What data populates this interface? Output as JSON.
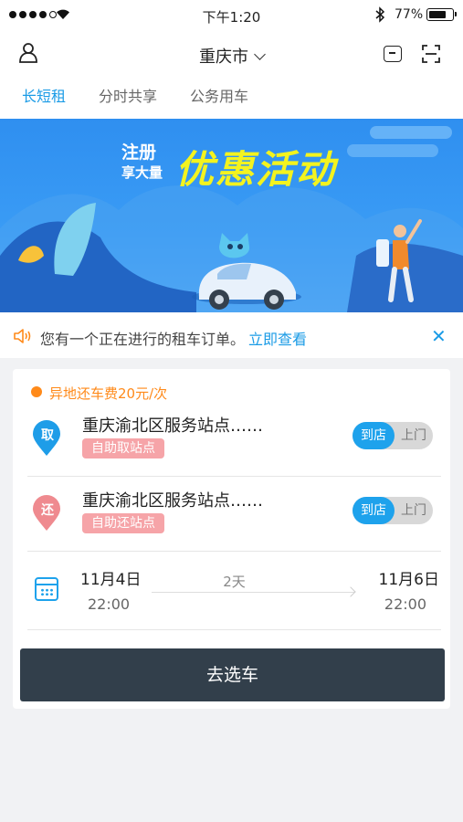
{
  "status_bar": {
    "time": "下午1:20",
    "battery_percent": "77%",
    "battery_level": 0.77
  },
  "header": {
    "city": "重庆市",
    "tabs": [
      {
        "label": "长短租",
        "active": true
      },
      {
        "label": "分时共享",
        "active": false
      },
      {
        "label": "公务用车",
        "active": false
      }
    ]
  },
  "banner": {
    "line1": "注册",
    "line2": "享大量",
    "main": "优惠活动"
  },
  "notice": {
    "text": "您有一个正在进行的租车订单。",
    "link": "立即查看"
  },
  "rental": {
    "fee_note": "异地还车费20元/次",
    "pickup": {
      "badge": "取",
      "location": "重庆渝北区服务站点……",
      "tag": "自助取站点",
      "option_selected": "到店",
      "option_other": "上门"
    },
    "return": {
      "badge": "还",
      "location": "重庆渝北区服务站点……",
      "tag": "自助还站点",
      "option_selected": "到店",
      "option_other": "上门"
    },
    "dates": {
      "start_date": "11月4日",
      "start_time": "22:00",
      "duration": "2天",
      "end_date": "11月6日",
      "end_time": "22:00"
    },
    "cta": "去选车"
  },
  "colors": {
    "accent": "#1a9be6",
    "fee": "#ff8a1a",
    "cta": "#323f4b",
    "tag": "#f6a4a8"
  }
}
